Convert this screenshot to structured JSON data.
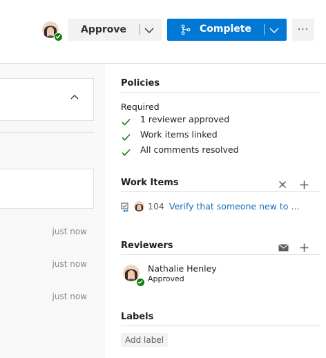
{
  "header": {
    "approve_label": "Approve",
    "complete_label": "Complete",
    "more_label": "···"
  },
  "activity": {
    "timestamps": [
      "just now",
      "just now",
      "just now"
    ]
  },
  "policies": {
    "title": "Policies",
    "required_label": "Required",
    "items": [
      "1 reviewer approved",
      "Work items linked",
      "All comments resolved"
    ]
  },
  "work_items": {
    "title": "Work Items",
    "items": [
      {
        "id": "104",
        "title": "Verify that someone new to the project can understand it"
      }
    ]
  },
  "reviewers": {
    "title": "Reviewers",
    "items": [
      {
        "name": "Nathalie Henley",
        "status": "Approved"
      }
    ]
  },
  "labels": {
    "title": "Labels",
    "add_label": "Add label"
  },
  "colors": {
    "accent": "#0078d4",
    "success": "#107c10",
    "link": "#0f6cbd"
  }
}
